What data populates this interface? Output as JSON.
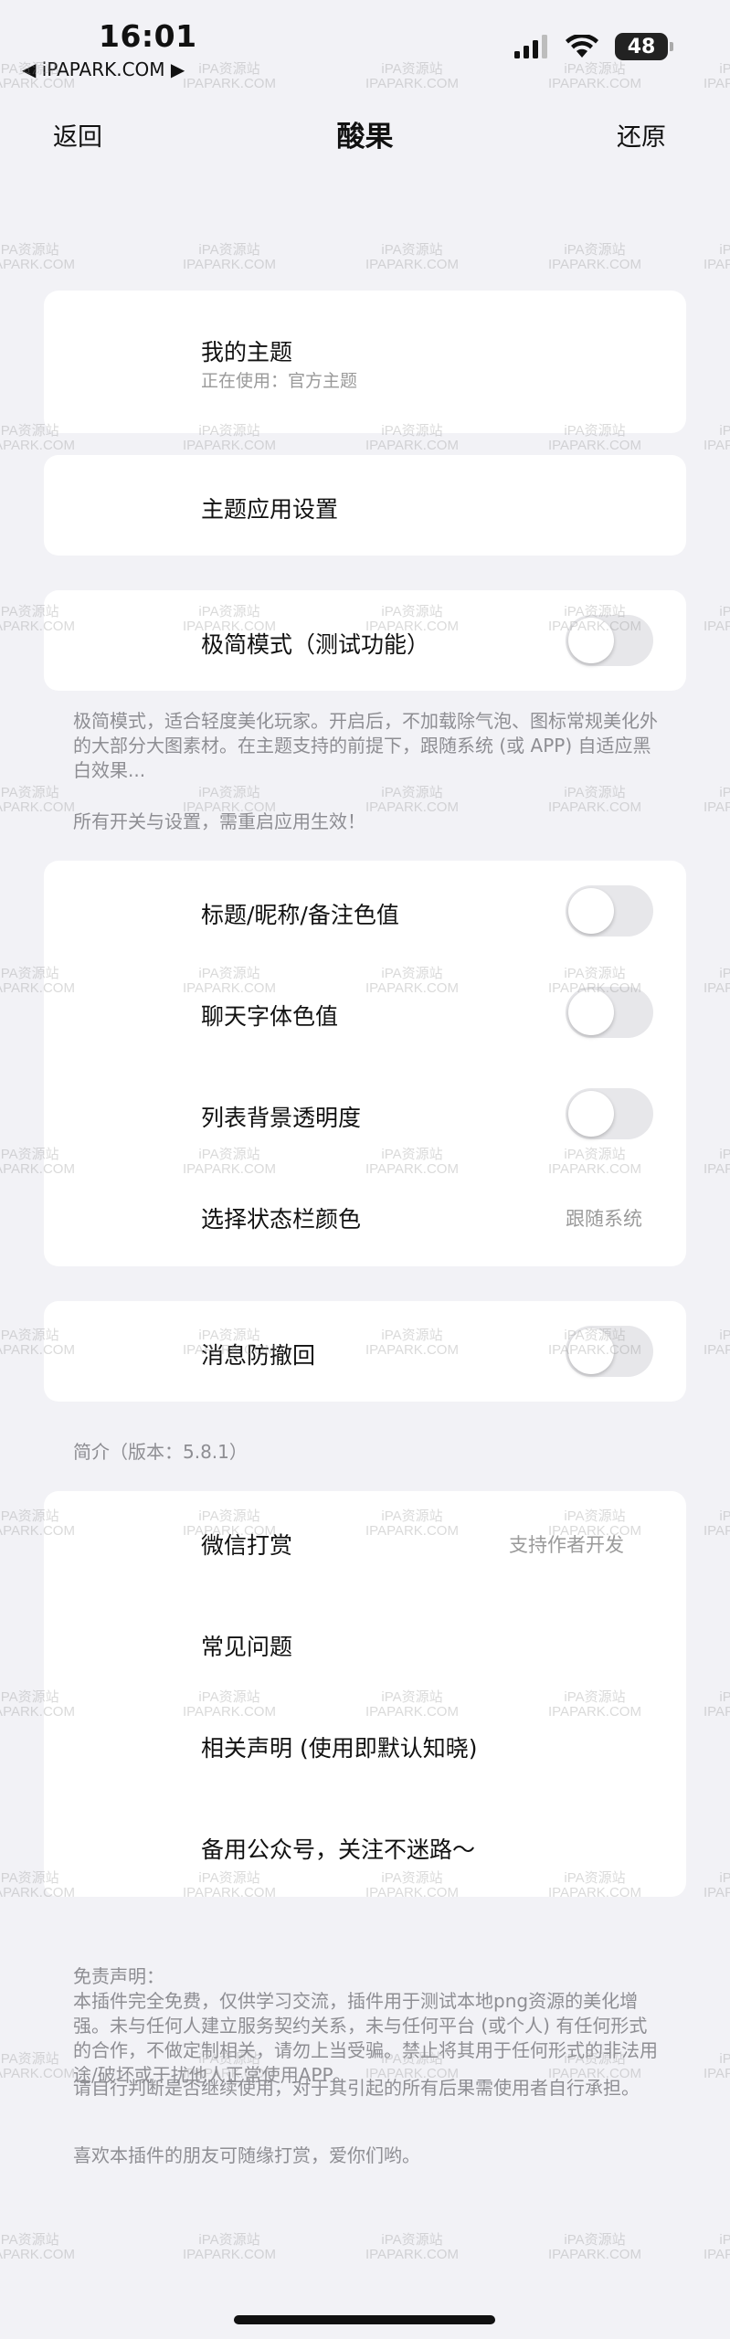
{
  "status_bar": {
    "time": "16:01",
    "back_app": "◀ iPAPARK.COM ▶",
    "battery": "48",
    "icons": [
      "cellular-signal-icon",
      "wifi-icon",
      "battery-icon"
    ]
  },
  "nav": {
    "back": "返回",
    "title": "酸果",
    "restore": "还原"
  },
  "theme_card": {
    "title": "我的主题",
    "subtitle": "正在使用：官方主题"
  },
  "theme_settings": {
    "label": "主题应用设置"
  },
  "minimal_mode": {
    "label": "极简模式（测试功能）",
    "on": false
  },
  "minimal_note": "极简模式，适合轻度美化玩家。开启后，不加载除气泡、图标常规美化外的大部分大图素材。在主题支持的前提下，跟随系统 (或 APP) 自适应黑白效果...",
  "restart_note": "所有开关与设置，需重启应用生效！",
  "color_settings": {
    "title_color": "标题/昵称/备注色值",
    "chat_font_color": "聊天字体色值",
    "list_opacity": "列表背景透明度",
    "status_bar_color": "选择状态栏颜色",
    "status_bar_value": "跟随系统"
  },
  "anti_recall": {
    "label": "消息防撤回",
    "on": false
  },
  "intro_header": "简介（版本：5.8.1）",
  "about": {
    "wechat_reward": "微信打赏",
    "wechat_reward_value": "支持作者开发",
    "faq": "常见问题",
    "statement": "相关声明 (使用即默认知晓)",
    "backup_account": "备用公众号，关注不迷路～"
  },
  "disclaimer": {
    "heading": "免责声明：",
    "body": "本插件完全免费，仅供学习交流，插件用于测试本地png资源的美化增强。未与任何人建立服务契约关系，未与任何平台 (或个人) 有任何形式的合作，不做定制相关，请勿上当受骗。禁止将其用于任何形式的非法用途/破坏或干扰他人正常使用APP。",
    "advice": "请自行判断是否继续使用，对于其引起的所有后果需使用者自行承担。",
    "thanks": "喜欢本插件的朋友可随缘打赏，爱你们哟。"
  },
  "watermark": {
    "line1": "iPA资源站",
    "line2": "IPAPARK.COM"
  },
  "colors": {
    "background": "#f2f2f6",
    "card": "#ffffff",
    "secondary_text": "#9a9a9a",
    "toggle_off": "#e7e7ea"
  }
}
